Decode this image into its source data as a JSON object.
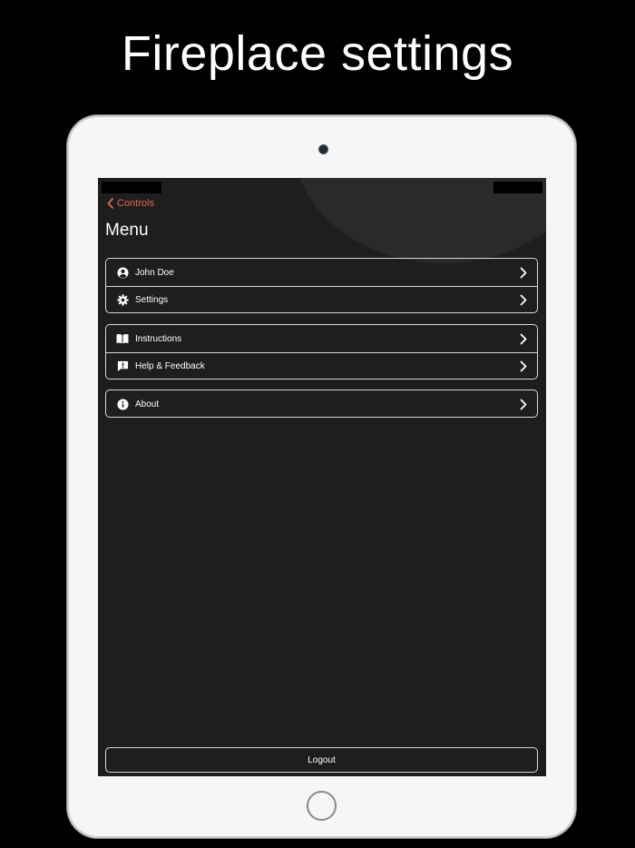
{
  "headline": "Fireplace settings",
  "nav": {
    "back_label": "Controls"
  },
  "menu": {
    "title": "Menu",
    "groups": [
      {
        "items": [
          {
            "label": "John Doe",
            "icon": "user-icon"
          },
          {
            "label": "Settings",
            "icon": "gear-icon"
          }
        ]
      },
      {
        "items": [
          {
            "label": "Instructions",
            "icon": "book-icon"
          },
          {
            "label": "Help & Feedback",
            "icon": "feedback-icon"
          }
        ]
      },
      {
        "items": [
          {
            "label": "About",
            "icon": "info-icon"
          }
        ]
      }
    ]
  },
  "logout_label": "Logout",
  "colors": {
    "accent": "#d96a4c",
    "screen_bg": "#1e1e1f",
    "border": "#d9d9d9",
    "device_frame": "#f5f6f7"
  }
}
